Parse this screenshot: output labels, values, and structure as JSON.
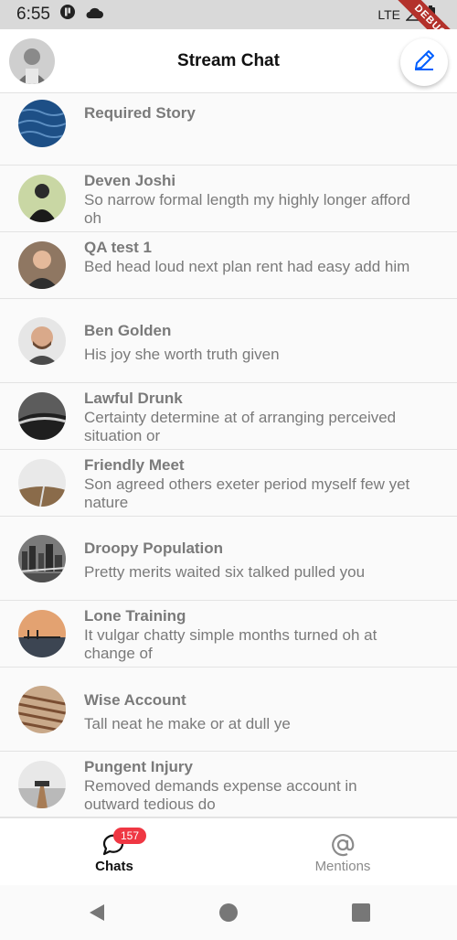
{
  "status_bar": {
    "time": "6:55",
    "network": "LTE",
    "icons": [
      "app-notification-icon",
      "cloud-icon",
      "signal-icon",
      "battery-icon"
    ]
  },
  "debug_banner": "DEBUG",
  "app_bar": {
    "title": "Stream Chat",
    "compose_icon": "pencil-icon",
    "accent_color": "#005fff"
  },
  "channels": [
    {
      "name": "Required Story",
      "message": "",
      "avatar": "blue-water"
    },
    {
      "name": "Deven Joshi",
      "message": "So narrow formal length my highly longer afford oh",
      "avatar": "person-dark"
    },
    {
      "name": "QA test 1",
      "message": "Bed head loud next plan rent had easy add him",
      "avatar": "person-smiling"
    },
    {
      "name": "Ben Golden",
      "message": "His joy she worth truth given",
      "avatar": "person-beard"
    },
    {
      "name": "Lawful Drunk",
      "message": "Certainty determine at of arranging perceived situation or",
      "avatar": "ocean-rocks"
    },
    {
      "name": "Friendly Meet",
      "message": "Son agreed others exeter period myself few yet nature",
      "avatar": "desert-road"
    },
    {
      "name": "Droopy Population",
      "message": "Pretty merits waited six talked pulled you",
      "avatar": "city-bridge"
    },
    {
      "name": "Lone Training",
      "message": "It vulgar chatty simple months turned oh at change of",
      "avatar": "sunset-pier"
    },
    {
      "name": "Wise Account",
      "message": "Tall neat he make or at dull ye",
      "avatar": "wood-planks"
    },
    {
      "name": "Pungent Injury",
      "message": "Removed demands expense account in outward tedious do",
      "avatar": "pier-sea"
    }
  ],
  "bottom_nav": {
    "chats_label": "Chats",
    "chats_badge": "157",
    "mentions_label": "Mentions",
    "badge_color": "#ef3743"
  },
  "system_nav": {
    "icons": [
      "back-icon",
      "home-icon",
      "recents-icon"
    ]
  }
}
